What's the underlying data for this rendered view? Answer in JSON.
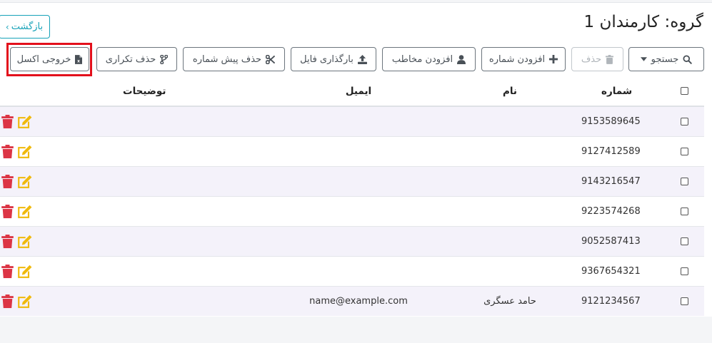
{
  "header": {
    "title": "گروه: کارمندان 1",
    "back_label": "بازگشت"
  },
  "toolbar": {
    "search_label": "جستجو",
    "delete_label": "حذف",
    "add_number_label": "افزودن شماره",
    "add_contact_label": "افزودن مخاطب",
    "upload_file_label": "بارگذاری فایل",
    "remove_prefix_label": "حذف پیش شماره",
    "remove_duplicates_label": "حذف تکراری",
    "export_excel_label": "خروجی اکسل"
  },
  "table": {
    "columns": {
      "phone": "شماره",
      "name": "نام",
      "email": "ایمیل",
      "description": "توضیحات"
    },
    "rows": [
      {
        "phone": "9153589645",
        "name": "",
        "email": "",
        "description": ""
      },
      {
        "phone": "9127412589",
        "name": "",
        "email": "",
        "description": ""
      },
      {
        "phone": "9143216547",
        "name": "",
        "email": "",
        "description": ""
      },
      {
        "phone": "9223574268",
        "name": "",
        "email": "",
        "description": ""
      },
      {
        "phone": "9052587413",
        "name": "",
        "email": "",
        "description": ""
      },
      {
        "phone": "9367654321",
        "name": "",
        "email": "",
        "description": ""
      },
      {
        "phone": "9121234567",
        "name": "حامد عسگری",
        "email": "name@example.com",
        "description": ""
      }
    ]
  },
  "colors": {
    "accent_info": "#17a2b8",
    "button_border": "#6c757d",
    "highlight": "#e3101c",
    "delete_icon": "#dc3545",
    "edit_icon": "#f0b90b",
    "row_stripe": "#f4f2fa"
  },
  "icons": {
    "search": "search-icon",
    "caret": "caret-down-icon",
    "trash": "trash-icon",
    "plus": "plus-icon",
    "user": "user-icon",
    "upload": "upload-icon",
    "scissors": "scissors-icon",
    "merge": "merge-icon",
    "excel": "excel-file-icon",
    "edit": "edit-icon"
  }
}
